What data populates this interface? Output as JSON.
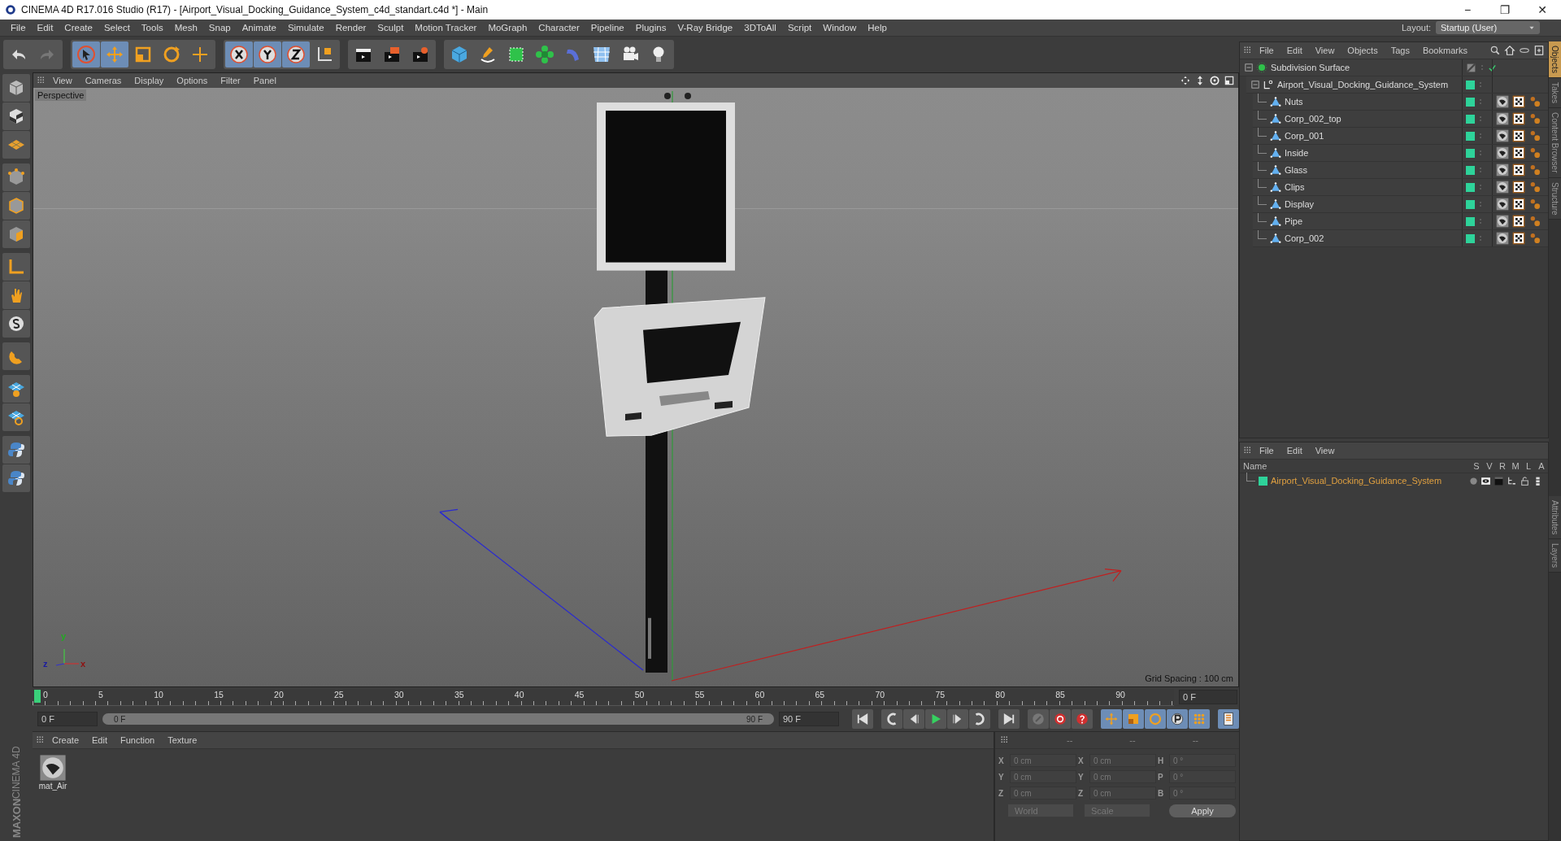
{
  "window": {
    "title": "CINEMA 4D R17.016 Studio (R17) - [Airport_Visual_Docking_Guidance_System_c4d_standart.c4d *] - Main",
    "controls": [
      "−",
      "❐",
      "✕"
    ]
  },
  "menu_bar": [
    "File",
    "Edit",
    "Create",
    "Select",
    "Tools",
    "Mesh",
    "Snap",
    "Animate",
    "Simulate",
    "Render",
    "Sculpt",
    "Motion Tracker",
    "MoGraph",
    "Character",
    "Pipeline",
    "Plugins",
    "V-Ray Bridge",
    "3DToAll",
    "Script",
    "Window",
    "Help"
  ],
  "layout": {
    "label": "Layout:",
    "value": "Startup (User)"
  },
  "viewport": {
    "menu": [
      "View",
      "Cameras",
      "Display",
      "Options",
      "Filter",
      "Panel"
    ],
    "camera": "Perspective",
    "grid_spacing": "Grid Spacing : 100 cm",
    "axis_labels": [
      "y",
      "z",
      "x"
    ]
  },
  "timeline": {
    "ticks": [
      "0",
      "5",
      "10",
      "15",
      "20",
      "25",
      "30",
      "35",
      "40",
      "45",
      "50",
      "55",
      "60",
      "65",
      "70",
      "75",
      "80",
      "85",
      "90"
    ],
    "current_frame": "0 F",
    "start_field": "0 F",
    "range_start": "0 F",
    "range_end": "90 F",
    "level": 1,
    "end_field": "90 F"
  },
  "material_manager": {
    "menu": [
      "Create",
      "Edit",
      "Function",
      "Texture"
    ],
    "materials": [
      {
        "name": "mat_Air"
      }
    ]
  },
  "coordinates": {
    "headers": [
      "--",
      "--",
      "--"
    ],
    "rows": [
      {
        "axis": "X",
        "position": "0 cm",
        "size_axis": "X",
        "size": "0 cm",
        "rot_axis": "H",
        "rotation": "0 °"
      },
      {
        "axis": "Y",
        "position": "0 cm",
        "size_axis": "Y",
        "size": "0 cm",
        "rot_axis": "P",
        "rotation": "0 °"
      },
      {
        "axis": "Z",
        "position": "0 cm",
        "size_axis": "Z",
        "size": "0 cm",
        "rot_axis": "B",
        "rotation": "0 °"
      }
    ],
    "mode": "World",
    "size_mode": "Scale",
    "apply": "Apply"
  },
  "object_manager": {
    "menu": [
      "File",
      "Edit",
      "View",
      "Objects",
      "Tags",
      "Bookmarks"
    ],
    "objects": [
      {
        "name": "Subdivision Surface",
        "kind": "generator",
        "expanded": true,
        "children": [
          {
            "name": "Airport_Visual_Docking_Guidance_System",
            "kind": "null",
            "expanded": true,
            "color": "#2ed39a",
            "children": [
              {
                "name": "Nuts",
                "kind": "polygon",
                "color": "#2ed39a"
              },
              {
                "name": "Corp_002_top",
                "kind": "polygon",
                "color": "#2ed39a"
              },
              {
                "name": "Corp_001",
                "kind": "polygon",
                "color": "#2ed39a"
              },
              {
                "name": "Inside",
                "kind": "polygon",
                "color": "#2ed39a"
              },
              {
                "name": "Glass",
                "kind": "polygon",
                "color": "#2ed39a"
              },
              {
                "name": "Clips",
                "kind": "polygon",
                "color": "#2ed39a"
              },
              {
                "name": "Display",
                "kind": "polygon",
                "color": "#2ed39a"
              },
              {
                "name": "Pipe",
                "kind": "polygon",
                "color": "#2ed39a"
              },
              {
                "name": "Corp_002",
                "kind": "polygon",
                "color": "#2ed39a"
              }
            ]
          }
        ]
      }
    ]
  },
  "layer_manager": {
    "menu": [
      "File",
      "Edit",
      "View"
    ],
    "columns": [
      "Name",
      "S",
      "V",
      "R",
      "M",
      "L",
      "A"
    ],
    "layers": [
      {
        "name": "Airport_Visual_Docking_Guidance_System",
        "color": "#2ed39a"
      }
    ]
  },
  "side_tabs": [
    {
      "label": "Objects",
      "selected": true
    },
    {
      "label": "Takes",
      "selected": false
    },
    {
      "label": "Content Browser",
      "selected": false
    },
    {
      "label": "Structure",
      "selected": false
    }
  ],
  "side_tabs_lower": [
    {
      "label": "Attributes",
      "selected": false
    },
    {
      "label": "Layers",
      "selected": false
    }
  ],
  "logo": [
    "MAXON",
    "CINEMA 4D"
  ]
}
